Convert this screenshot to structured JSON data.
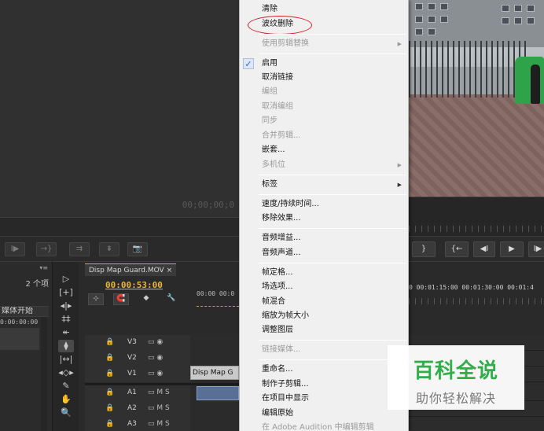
{
  "source_monitor": {
    "timecode": "00;00;00;0",
    "controls": [
      "I▶",
      "→}",
      "⇉",
      "⇟",
      "📷"
    ]
  },
  "program_monitor": {
    "controls": [
      "}",
      "{←",
      "◀I",
      "▶",
      "I▶"
    ]
  },
  "project_panel": {
    "count": "2 个项",
    "column_header": "媒体开始",
    "row_value": "0:00:00:00",
    "menu_icon": "▾≡"
  },
  "tools": [
    "▷",
    "[+]",
    "◂|▸",
    "‡‡",
    "↞",
    "⧫",
    "|↔|",
    "◂◇▸",
    "✎",
    "✋",
    "🔍"
  ],
  "timeline": {
    "tab_title": "Disp Map Guard.MOV ×",
    "timecode": "00:00:53:00",
    "toolbar_icons": [
      "⊹",
      "🧲",
      "◆",
      "🔧"
    ],
    "ruler": "00:00  00:0",
    "ruler_right": "0   00:01:15:00   00:01:30:00   00:01:4",
    "tracks": [
      {
        "name": "V3",
        "lock": "🔒"
      },
      {
        "name": "V2",
        "lock": "🔒"
      },
      {
        "name": "V1",
        "lock": "🔒"
      },
      {
        "name": "A1",
        "lock": "🔒"
      },
      {
        "name": "A2",
        "lock": "🔒"
      },
      {
        "name": "A3",
        "lock": "🔒"
      }
    ],
    "v_icons": "▭ ◉",
    "a_icons": "▭ M S",
    "v1_clip": "Disp Map G"
  },
  "context_menu": {
    "items": [
      {
        "label": "清除",
        "disabled": false
      },
      {
        "label": "波纹删除",
        "disabled": false
      },
      {
        "label": "使用剪辑替换",
        "disabled": true,
        "submenu": true
      },
      {
        "label": "启用",
        "disabled": false,
        "checked": true
      },
      {
        "label": "取消链接",
        "disabled": false
      },
      {
        "label": "编组",
        "disabled": true
      },
      {
        "label": "取消编组",
        "disabled": true
      },
      {
        "label": "同步",
        "disabled": true
      },
      {
        "label": "合并剪辑...",
        "disabled": true
      },
      {
        "label": "嵌套...",
        "disabled": false
      },
      {
        "label": "多机位",
        "disabled": true,
        "submenu": true
      },
      {
        "label": "标签",
        "disabled": false,
        "submenu": true
      },
      {
        "label": "速度/持续时间...",
        "disabled": false
      },
      {
        "label": "移除效果...",
        "disabled": false
      },
      {
        "label": "音频增益...",
        "disabled": false
      },
      {
        "label": "音频声道...",
        "disabled": false
      },
      {
        "label": "帧定格...",
        "disabled": false
      },
      {
        "label": "场选项...",
        "disabled": false
      },
      {
        "label": "帧混合",
        "disabled": false
      },
      {
        "label": "缩放为帧大小",
        "disabled": false
      },
      {
        "label": "调整图层",
        "disabled": false
      },
      {
        "label": "链接媒体...",
        "disabled": true
      },
      {
        "label": "重命名...",
        "disabled": false
      },
      {
        "label": "制作子剪辑...",
        "disabled": false
      },
      {
        "label": "在项目中显示",
        "disabled": false
      },
      {
        "label": "编辑原始",
        "disabled": false
      },
      {
        "label": "在 Adobe Audition 中编辑剪辑",
        "disabled": true
      }
    ],
    "check_mark": "✓",
    "submenu_arrow": "▶"
  },
  "watermark": {
    "title": "百科全说",
    "subtitle": "助你轻松解决"
  },
  "colors": {
    "accent_timecode": "#e8b830",
    "highlight_circle": "#d2202a",
    "watermark_green": "#2fae4a"
  }
}
